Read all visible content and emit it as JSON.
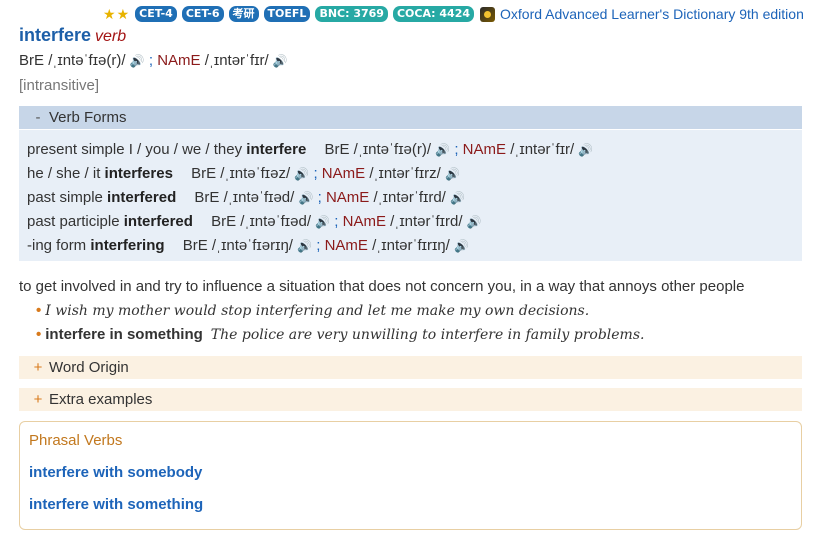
{
  "header": {
    "stars": [
      "★",
      "★"
    ],
    "badges": [
      {
        "label": "CET-4",
        "color": "#1f6fb5"
      },
      {
        "label": "CET-6",
        "color": "#1f6fb5"
      },
      {
        "label": "考研",
        "color": "#1f6fb5"
      },
      {
        "label": "TOEFL",
        "color": "#1f6fb5"
      },
      {
        "label": "BNC: 3769",
        "color": "#27a9a4"
      },
      {
        "label": "COCA: 4424",
        "color": "#27a9a4"
      }
    ],
    "dictionary_name": "Oxford Advanced Learner's Dictionary 9th edition"
  },
  "entry": {
    "headword": "interfere",
    "pos": "verb",
    "pron": {
      "bre_label": "BrE",
      "bre_ipa": "/ˌɪntəˈfɪə(r)/",
      "name_label": "NAmE",
      "name_ipa": "/ˌɪntərˈfɪr/"
    },
    "grammar": "[intransitive]"
  },
  "verb_forms": {
    "toggle": "-",
    "title": "Verb Forms",
    "rows": [
      {
        "label": "present simple I / you / we / they",
        "form": "interfere",
        "bre": "/ˌɪntəˈfɪə(r)/",
        "name": "/ˌɪntərˈfɪr/"
      },
      {
        "label": "he / she / it",
        "form": "interferes",
        "bre": "/ˌɪntəˈfɪəz/",
        "name": "/ˌɪntərˈfɪrz/"
      },
      {
        "label": "past simple",
        "form": "interfered",
        "bre": "/ˌɪntəˈfɪəd/",
        "name": "/ˌɪntərˈfɪrd/"
      },
      {
        "label": "past participle",
        "form": "interfered",
        "bre": "/ˌɪntəˈfɪəd/",
        "name": "/ˌɪntərˈfɪrd/"
      },
      {
        "label": "-ing form",
        "form": "interfering",
        "bre": "/ˌɪntəˈfɪərɪŋ/",
        "name": "/ˌɪntərˈfɪrɪŋ/"
      }
    ],
    "bre_label": "BrE",
    "name_label": "NAmE",
    "separator": ";"
  },
  "sense": {
    "definition": "to get involved in and try to influence a situation that does not concern you, in a way that annoys other people",
    "examples": [
      {
        "cf": "",
        "text": "I wish my mother would stop interfering and let me make my own decisions."
      },
      {
        "cf": "interfere in something",
        "text": "The police are very unwilling to interfere in family problems."
      }
    ]
  },
  "sections": {
    "word_origin": {
      "toggle": "+",
      "label": "Word Origin"
    },
    "extra_examples": {
      "toggle": "+",
      "label": "Extra examples"
    }
  },
  "phrasal_verbs": {
    "title": "Phrasal Verbs",
    "items": [
      "interfere with somebody",
      "interfere with something"
    ]
  },
  "icons": {
    "speaker_bre": "speaker-icon-blue",
    "speaker_name": "speaker-icon-red",
    "dictionary": "oald-dictionary-icon"
  },
  "colors": {
    "headword": "#1d5fa8",
    "verb_forms_header": "#c7d6e8",
    "verb_forms_body": "#e8eff7",
    "fold_bg": "#fbf1e2",
    "link": "#1d64b9",
    "phrasal_title": "#c2781e"
  }
}
